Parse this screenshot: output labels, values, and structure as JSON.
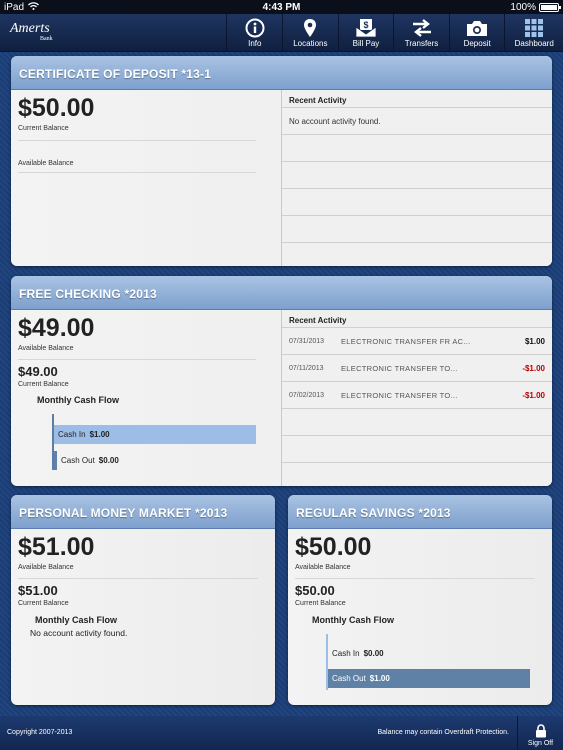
{
  "status": {
    "device": "iPad",
    "time": "4:43 PM",
    "battery": "100%"
  },
  "brand": {
    "name": "Amerts",
    "sub": "Bank"
  },
  "nav": [
    {
      "label": "Info",
      "icon": "info-icon"
    },
    {
      "label": "Locations",
      "icon": "map-pin-icon"
    },
    {
      "label": "Bill Pay",
      "icon": "bill-pay-icon"
    },
    {
      "label": "Transfers",
      "icon": "transfer-arrows-icon"
    },
    {
      "label": "Deposit",
      "icon": "camera-icon"
    },
    {
      "label": "Dashboard",
      "icon": "grid-icon"
    }
  ],
  "cd": {
    "title": "CERTIFICATE OF DEPOSIT *13-1",
    "amount": "$50.00",
    "amount_label": "Current Balance",
    "available_label": "Available Balance",
    "activity_title": "Recent Activity",
    "activity_empty": "No account activity found."
  },
  "checking": {
    "title": "FREE CHECKING *2013",
    "amount": "$49.00",
    "amount_label": "Available Balance",
    "current": "$49.00",
    "current_label": "Current Balance",
    "flow_title": "Monthly Cash Flow",
    "cash_in_label": "Cash In",
    "cash_in": "$1.00",
    "cash_out_label": "Cash Out",
    "cash_out": "$0.00",
    "activity_title": "Recent Activity",
    "activity": [
      {
        "date": "07/31/2013",
        "desc": "ELECTRONIC TRANSFER FR AC...",
        "amount": "$1.00"
      },
      {
        "date": "07/11/2013",
        "desc": "ELECTRONIC TRANSFER TO...",
        "amount": "-$1.00"
      },
      {
        "date": "07/02/2013",
        "desc": "ELECTRONIC TRANSFER TO...",
        "amount": "-$1.00"
      }
    ]
  },
  "money_market": {
    "title": "PERSONAL MONEY MARKET *2013",
    "amount": "$51.00",
    "amount_label": "Available Balance",
    "current": "$51.00",
    "current_label": "Current Balance",
    "flow_title": "Monthly Cash Flow",
    "flow_empty": "No account activity found."
  },
  "savings": {
    "title": "REGULAR SAVINGS *2013",
    "amount": "$50.00",
    "amount_label": "Available Balance",
    "current": "$50.00",
    "current_label": "Current Balance",
    "flow_title": "Monthly Cash Flow",
    "cash_in_label": "Cash In",
    "cash_in": "$0.00",
    "cash_out_label": "Cash Out",
    "cash_out": "$1.00"
  },
  "footer": {
    "copyright": "Copyright 2007-2013",
    "note": "Balance may contain Overdraft Protection.",
    "signoff": "Sign Off"
  }
}
